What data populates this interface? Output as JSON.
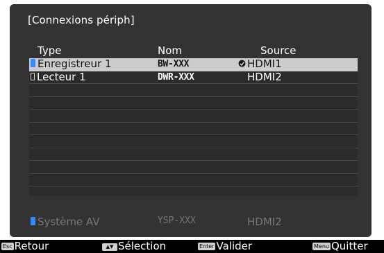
{
  "title": "[Connexions périph]",
  "headers": {
    "type": "Type",
    "name": "Nom",
    "source": "Source"
  },
  "devices": [
    {
      "type": "Enregistreur 1",
      "name": "BW-XXX",
      "source": "HDMI1",
      "selected": true,
      "icon": "device-filled-icon",
      "active_source": true
    },
    {
      "type": "Lecteur 1",
      "name": "DWR-XXX",
      "source": "HDMI2",
      "selected": false,
      "icon": "device-outline-icon",
      "active_source": false
    }
  ],
  "empty_row_count": 9,
  "av_system": {
    "type": "Système AV",
    "name": "YSP-XXX",
    "source": "HDMI2"
  },
  "footer": {
    "back": {
      "key": "Esc",
      "label": "Retour"
    },
    "select": {
      "key": "▲▼",
      "label": "Sélection"
    },
    "enter": {
      "key": "Enter",
      "label": "Valider"
    },
    "quit": {
      "key": "Menu",
      "label": "Quitter"
    }
  },
  "colors": {
    "panel": "#333333",
    "selection": "#cccccc",
    "accent_blue": "#2f8dff",
    "disabled_text": "#777777"
  }
}
